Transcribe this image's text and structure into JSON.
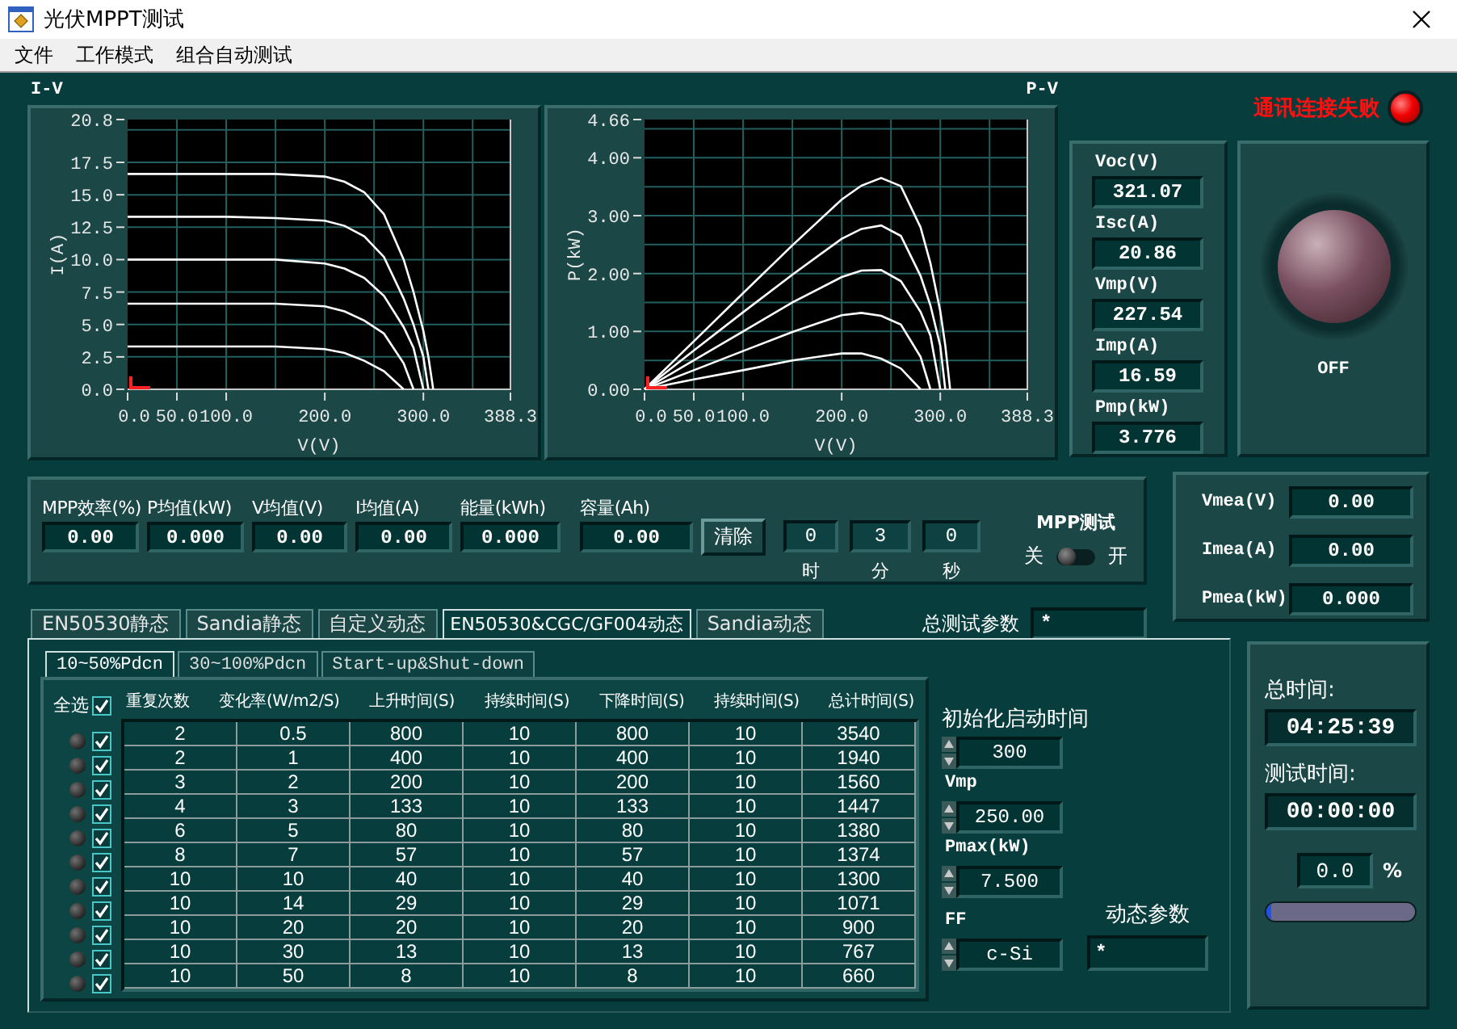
{
  "window": {
    "title": "光伏MPPT测试"
  },
  "menu": [
    "文件",
    "工作模式",
    "组合自动测试"
  ],
  "iv_chart": {
    "chart_data": {
      "type": "line",
      "grid": true,
      "title": "I-V",
      "xlabel": "V(V)",
      "ylabel": "I(A)",
      "x": [
        0,
        50,
        100,
        150,
        200,
        220,
        240,
        260,
        280,
        290,
        300,
        305,
        310
      ],
      "xlim": [
        0,
        388.3
      ],
      "ylim": [
        0,
        20.8
      ],
      "xticks": [
        {
          "value": 0,
          "label": "0.0"
        },
        {
          "value": 50,
          "label": "50.0"
        },
        {
          "value": 100,
          "label": "100.0"
        },
        {
          "value": 200,
          "label": "200.0"
        },
        {
          "value": 300,
          "label": "300.0"
        },
        {
          "value": 388.3,
          "label": "388.3"
        }
      ],
      "yticks": [
        {
          "value": 0,
          "label": "0.0"
        },
        {
          "value": 2.5,
          "label": "2.5"
        },
        {
          "value": 5,
          "label": "5.0"
        },
        {
          "value": 7.5,
          "label": "7.5"
        },
        {
          "value": 10,
          "label": "10.0"
        },
        {
          "value": 12.5,
          "label": "12.5"
        },
        {
          "value": 15,
          "label": "15.0"
        },
        {
          "value": 17.5,
          "label": "17.5"
        },
        {
          "value": 20.8,
          "label": "20.8"
        }
      ],
      "series": [
        {
          "values": [
            16.6,
            16.6,
            16.6,
            16.6,
            16.4,
            16.0,
            15.2,
            13.5,
            10.0,
            7.5,
            4.5,
            2.5,
            0
          ]
        },
        {
          "values": [
            13.3,
            13.3,
            13.3,
            13.2,
            13.0,
            12.6,
            11.8,
            10.2,
            7.0,
            5.0,
            2.5,
            0,
            null
          ]
        },
        {
          "values": [
            10.0,
            10.0,
            10.0,
            10.0,
            9.7,
            9.3,
            8.6,
            7.2,
            4.8,
            3.2,
            0,
            null,
            null
          ]
        },
        {
          "values": [
            6.6,
            6.6,
            6.6,
            6.6,
            6.4,
            6.0,
            5.3,
            4.3,
            2.0,
            0,
            null,
            null,
            null
          ]
        },
        {
          "values": [
            3.3,
            3.3,
            3.3,
            3.3,
            3.1,
            2.8,
            2.2,
            1.4,
            0,
            null,
            null,
            null,
            null
          ]
        }
      ]
    }
  },
  "pv_chart": {
    "chart_data": {
      "type": "line",
      "grid": true,
      "title": "P-V",
      "xlabel": "V(V)",
      "ylabel": "P(kW)",
      "x": [
        0,
        50,
        100,
        150,
        200,
        220,
        240,
        260,
        280,
        290,
        300,
        305,
        310
      ],
      "xlim": [
        0,
        388.3
      ],
      "ylim": [
        0,
        4.66
      ],
      "xticks": [
        {
          "value": 0,
          "label": "0.0"
        },
        {
          "value": 50,
          "label": "50.0"
        },
        {
          "value": 100,
          "label": "100.0"
        },
        {
          "value": 200,
          "label": "200.0"
        },
        {
          "value": 300,
          "label": "300.0"
        },
        {
          "value": 388.3,
          "label": "388.3"
        }
      ],
      "yticks": [
        {
          "value": 0,
          "label": "0.00"
        },
        {
          "value": 1,
          "label": "1.00"
        },
        {
          "value": 2,
          "label": "2.00"
        },
        {
          "value": 3,
          "label": "3.00"
        },
        {
          "value": 4,
          "label": "4.00"
        },
        {
          "value": 4.66,
          "label": "4.66"
        }
      ],
      "series": [
        {
          "values": [
            0,
            0.83,
            1.66,
            2.49,
            3.28,
            3.52,
            3.65,
            3.51,
            2.8,
            2.18,
            1.35,
            0.76,
            0
          ]
        },
        {
          "values": [
            0,
            0.67,
            1.33,
            1.98,
            2.6,
            2.77,
            2.83,
            2.65,
            1.96,
            1.45,
            0.75,
            0,
            null
          ]
        },
        {
          "values": [
            0,
            0.5,
            1.0,
            1.5,
            1.94,
            2.05,
            2.06,
            1.87,
            1.34,
            0.93,
            0,
            null,
            null
          ]
        },
        {
          "values": [
            0,
            0.33,
            0.66,
            0.99,
            1.28,
            1.32,
            1.27,
            1.12,
            0.56,
            0,
            null,
            null,
            null
          ]
        },
        {
          "values": [
            0,
            0.17,
            0.33,
            0.5,
            0.62,
            0.62,
            0.53,
            0.36,
            0,
            null,
            null,
            null,
            null
          ]
        }
      ]
    }
  },
  "connection_status": {
    "text": "通讯连接失败",
    "lit": true
  },
  "readings": [
    {
      "label": "Voc(V)",
      "value": "321.07"
    },
    {
      "label": "Isc(A)",
      "value": "20.86"
    },
    {
      "label": "Vmp(V)",
      "value": "227.54"
    },
    {
      "label": "Imp(A)",
      "value": "16.59"
    },
    {
      "label": "Pmp(kW)",
      "value": "3.776"
    }
  ],
  "power_button": {
    "label": "OFF",
    "on": false
  },
  "averages": [
    {
      "label": "MPP效率(%)",
      "value": "0.00"
    },
    {
      "label": "P均值(kW)",
      "value": "0.000"
    },
    {
      "label": "V均值(V)",
      "value": "0.00"
    },
    {
      "label": "I均值(A)",
      "value": "0.00"
    },
    {
      "label": "能量(kWh)",
      "value": "0.000"
    },
    {
      "label": "容量(Ah)",
      "value": "0.00"
    }
  ],
  "clear_button": "清除",
  "timer": [
    {
      "value": "0",
      "unit": "时"
    },
    {
      "value": "3",
      "unit": "分"
    },
    {
      "value": "0",
      "unit": "秒"
    }
  ],
  "mpp_switch": {
    "label": "MPP测试",
    "off_label": "关",
    "on_label": "开",
    "on": false
  },
  "measurements": [
    {
      "label": "Vmea(V)",
      "value": "0.00"
    },
    {
      "label": "Imea(A)",
      "value": "0.00"
    },
    {
      "label": "Pmea(kW)",
      "value": "0.000"
    }
  ],
  "tabs": [
    {
      "label": "EN50530静态",
      "selected": false
    },
    {
      "label": "Sandia静态",
      "selected": false
    },
    {
      "label": "自定义动态",
      "selected": false
    },
    {
      "label": "EN50530&CGC/GF004动态",
      "selected": true
    },
    {
      "label": "Sandia动态",
      "selected": false
    }
  ],
  "total_params": {
    "label": "总测试参数",
    "value": "*"
  },
  "subtabs": [
    {
      "label": "10~50%Pdcn",
      "selected": true
    },
    {
      "label": "30~100%Pdcn",
      "selected": false
    },
    {
      "label": "Start-up&Shut-down",
      "selected": false
    }
  ],
  "select_all": {
    "label": "全选",
    "checked": true
  },
  "table": {
    "columns": [
      "重复次数",
      "变化率(W/m2/S)",
      "上升时间(S)",
      "持续时间(S)",
      "下降时间(S)",
      "持续时间(S)",
      "总计时间(S)"
    ],
    "rows": [
      {
        "cells": [
          "2",
          "0.5",
          "800",
          "10",
          "800",
          "10",
          "3540"
        ],
        "checked": true,
        "active": false
      },
      {
        "cells": [
          "2",
          "1",
          "400",
          "10",
          "400",
          "10",
          "1940"
        ],
        "checked": true,
        "active": false
      },
      {
        "cells": [
          "3",
          "2",
          "200",
          "10",
          "200",
          "10",
          "1560"
        ],
        "checked": true,
        "active": false
      },
      {
        "cells": [
          "4",
          "3",
          "133",
          "10",
          "133",
          "10",
          "1447"
        ],
        "checked": true,
        "active": false
      },
      {
        "cells": [
          "6",
          "5",
          "80",
          "10",
          "80",
          "10",
          "1380"
        ],
        "checked": true,
        "active": false
      },
      {
        "cells": [
          "8",
          "7",
          "57",
          "10",
          "57",
          "10",
          "1374"
        ],
        "checked": true,
        "active": false
      },
      {
        "cells": [
          "10",
          "10",
          "40",
          "10",
          "40",
          "10",
          "1300"
        ],
        "checked": true,
        "active": false
      },
      {
        "cells": [
          "10",
          "14",
          "29",
          "10",
          "29",
          "10",
          "1071"
        ],
        "checked": true,
        "active": false
      },
      {
        "cells": [
          "10",
          "20",
          "20",
          "10",
          "20",
          "10",
          "900"
        ],
        "checked": true,
        "active": false
      },
      {
        "cells": [
          "10",
          "30",
          "13",
          "10",
          "13",
          "10",
          "767"
        ],
        "checked": true,
        "active": false
      },
      {
        "cells": [
          "10",
          "50",
          "8",
          "10",
          "8",
          "10",
          "660"
        ],
        "checked": true,
        "active": false
      }
    ]
  },
  "dynamic_settings": [
    {
      "label": "初始化启动时间",
      "value": "300"
    },
    {
      "label": "Vmp",
      "value": "250.00"
    },
    {
      "label": "Pmax(kW)",
      "value": "7.500"
    },
    {
      "label": "FF",
      "value": "c-Si"
    }
  ],
  "dynamic_params": {
    "label": "动态参数",
    "value": "*"
  },
  "total_time": {
    "label": "总时间:",
    "value": "04:25:39"
  },
  "test_time": {
    "label": "测试时间:",
    "value": "00:00:00"
  },
  "progress": {
    "reading": "0.0",
    "unit": "%",
    "level": 0.03
  }
}
